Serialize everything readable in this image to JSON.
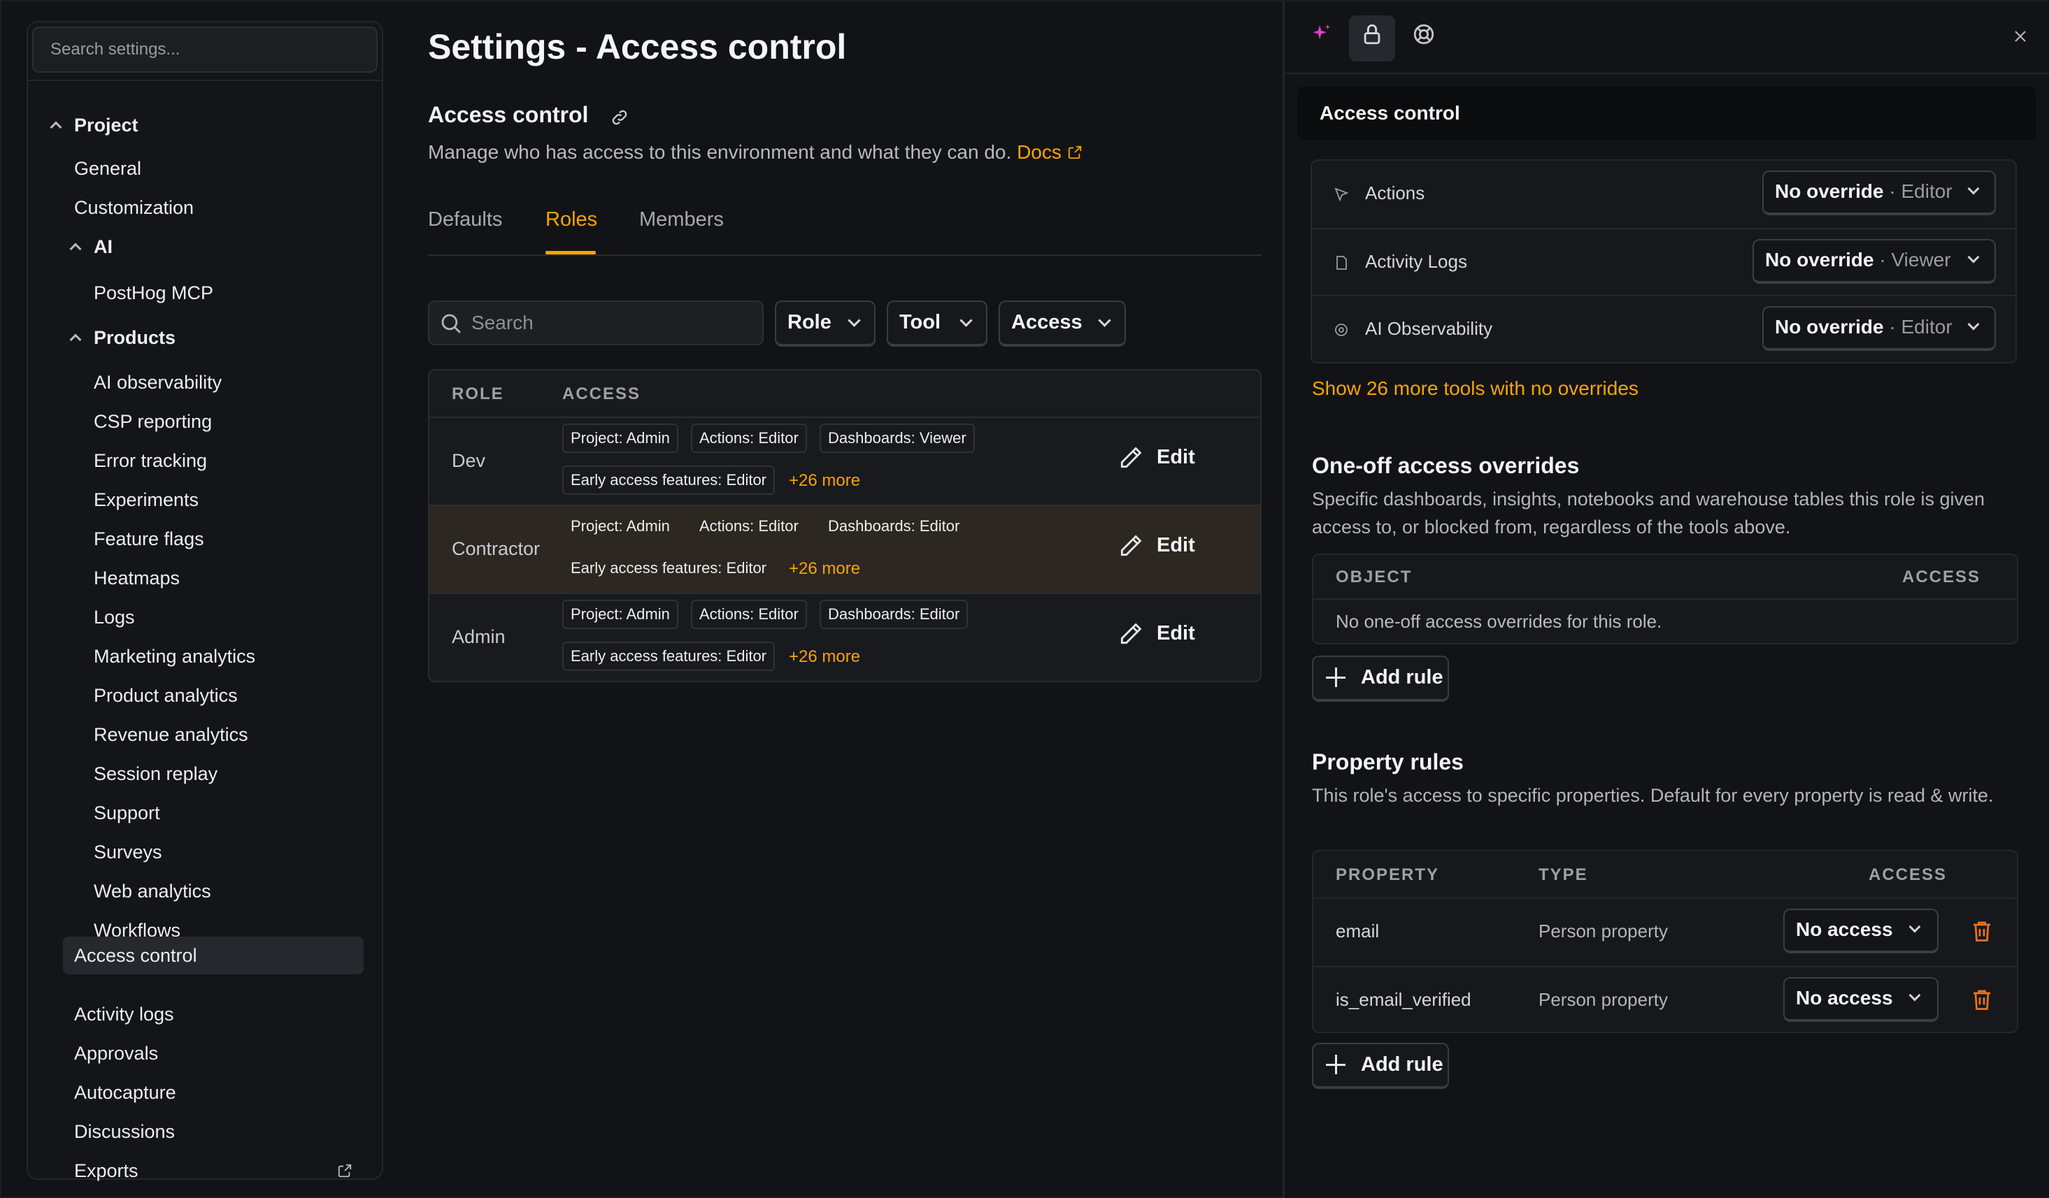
{
  "sidebar": {
    "search_placeholder": "Search settings...",
    "project_label": "Project",
    "general": "General",
    "customization": "Customization",
    "ai_label": "AI",
    "posthog_mcp": "PostHog MCP",
    "products_label": "Products",
    "products": [
      "AI observability",
      "CSP reporting",
      "Error tracking",
      "Experiments",
      "Feature flags",
      "Heatmaps",
      "Logs",
      "Marketing analytics",
      "Product analytics",
      "Revenue analytics",
      "Session replay",
      "Support",
      "Surveys",
      "Web analytics",
      "Workflows"
    ],
    "access_control": "Access control",
    "activity_logs": "Activity logs",
    "approvals": "Approvals",
    "autocapture": "Autocapture",
    "discussions": "Discussions",
    "exports": "Exports"
  },
  "main": {
    "title": "Settings - Access control",
    "section_title": "Access control",
    "description": "Manage who has access to this environment and what they can do.",
    "docs_link": "Docs",
    "tabs": [
      "Defaults",
      "Roles",
      "Members"
    ],
    "active_tab": "Roles",
    "search_placeholder": "Search",
    "filters": [
      "Role",
      "Tool",
      "Access"
    ],
    "table": {
      "headers": [
        "ROLE",
        "ACCESS"
      ],
      "edit_label": "Edit",
      "rows": [
        {
          "role": "Dev",
          "chips": [
            "Project: Admin",
            "Actions: Editor",
            "Dashboards: Viewer",
            "Early access features: Editor"
          ],
          "more": "+26 more"
        },
        {
          "role": "Contractor",
          "chips": [
            "Project: Admin",
            "Actions: Editor",
            "Dashboards: Editor",
            "Early access features: Editor"
          ],
          "more": "+26 more"
        },
        {
          "role": "Admin",
          "chips": [
            "Project: Admin",
            "Actions: Editor",
            "Dashboards: Editor",
            "Early access features: Editor"
          ],
          "more": "+26 more"
        }
      ]
    }
  },
  "panel": {
    "header_title": "Access control",
    "tools": [
      {
        "name": "Actions",
        "override": "No override",
        "level": "Editor"
      },
      {
        "name": "Activity Logs",
        "override": "No override",
        "level": "Viewer"
      },
      {
        "name": "AI Observability",
        "override": "No override",
        "level": "Editor"
      }
    ],
    "show_more": "Show 26 more tools with no overrides",
    "oneoff": {
      "title": "One-off access overrides",
      "description": "Specific dashboards, insights, notebooks and warehouse tables this role is given access to, or blocked from, regardless of the tools above.",
      "headers": [
        "OBJECT",
        "ACCESS"
      ],
      "empty": "No one-off access overrides for this role.",
      "add_rule": "Add rule"
    },
    "property_rules": {
      "title": "Property rules",
      "description": "This role's access to specific properties. Default for every property is read & write.",
      "headers": [
        "PROPERTY",
        "TYPE",
        "ACCESS"
      ],
      "rows": [
        {
          "property": "email",
          "type": "Person property",
          "access": "No access"
        },
        {
          "property": "is_email_verified",
          "type": "Person property",
          "access": "No access"
        }
      ],
      "add_rule": "Add rule"
    }
  },
  "colors": {
    "accent": "#f7a500",
    "danger": "#e8731f",
    "sparkle": "#e040c8"
  }
}
